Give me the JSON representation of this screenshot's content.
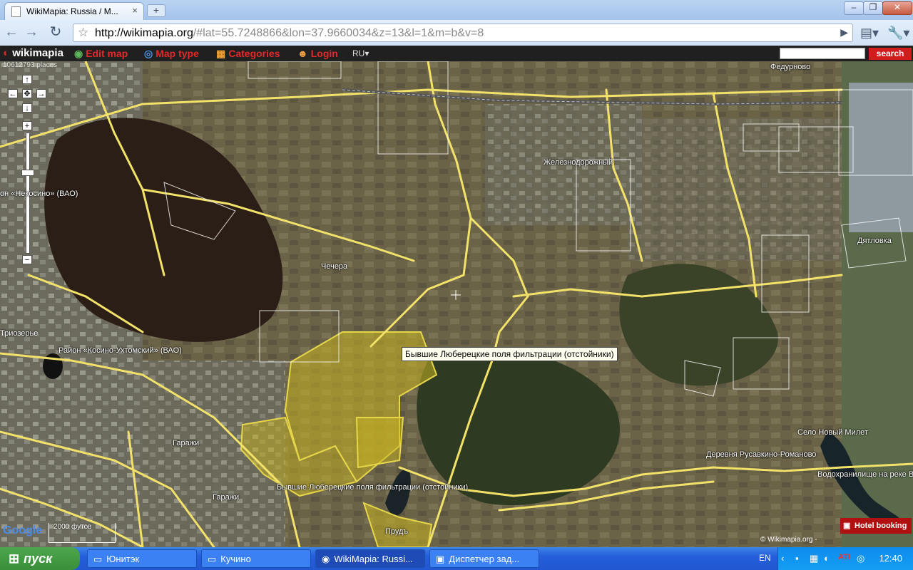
{
  "browser": {
    "tab_title": "WikiMapia: Russia / M...",
    "tab_close": "×",
    "new_tab": "+",
    "url_host": "http://wikimapia.org",
    "url_rest": "/#lat=55.7248866&lon=37.9660034&z=13&l=1&m=b&v=8",
    "win_minimize": "–",
    "win_maximize": "❐",
    "win_close": "✕"
  },
  "wikimapia": {
    "logo": "wikimapia",
    "places_count": "10612793 places",
    "menu": [
      {
        "label": "Edit map"
      },
      {
        "label": "Map type"
      },
      {
        "label": "Categories"
      },
      {
        "label": "Login"
      }
    ],
    "language": "RU",
    "search_button": "search"
  },
  "map": {
    "labels": [
      {
        "text": "Федурново"
      },
      {
        "text": "Железнодорожный"
      },
      {
        "text": "он «Некосино» (ВАО)"
      },
      {
        "text": "Дятловка"
      },
      {
        "text": "Чечера"
      },
      {
        "text": "Триозерье"
      },
      {
        "text": "Район «Косино-Ухтомский» (ВАО)"
      },
      {
        "text": "Село Новый Милет"
      },
      {
        "text": "Деревня Русавкино-Романово"
      },
      {
        "text": "Водохранилище на реке Вы"
      },
      {
        "text": "Гаражи"
      },
      {
        "text": "Гаражи"
      },
      {
        "text": "Бывшие Люберецкие поля фильтрации (отстойники)"
      },
      {
        "text": "Прудъ"
      }
    ],
    "tooltip": "Бывшие Люберецкие поля фильтрации (отстойники)",
    "hotel_booking": "Hotel booking",
    "copyright": "© Wikimapia.org -",
    "scale": "2000 футов",
    "google_logo": "Google",
    "highlight_color": "#c8b420",
    "road_color": "#f3e26a"
  },
  "taskbar": {
    "start": "пуск",
    "tasks": [
      {
        "label": "Юнитэк",
        "icon": "folder-icon"
      },
      {
        "label": "Кучино",
        "icon": "folder-icon"
      },
      {
        "label": "WikiMapia: Russi...",
        "icon": "chrome-icon"
      },
      {
        "label": "Диспетчер зад...",
        "icon": "task-manager-icon"
      }
    ],
    "language": "EN",
    "clock": "12:40"
  }
}
